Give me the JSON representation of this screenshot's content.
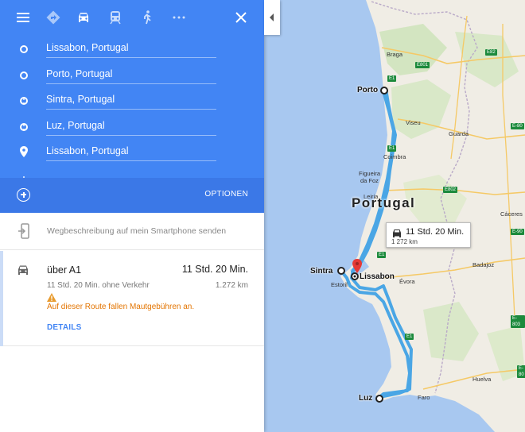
{
  "travel_modes": [
    {
      "name": "menu",
      "icon": "menu-icon"
    },
    {
      "name": "best",
      "icon": "directions-diamond-icon"
    },
    {
      "name": "car",
      "icon": "car-icon",
      "active": true
    },
    {
      "name": "transit",
      "icon": "train-icon"
    },
    {
      "name": "walk",
      "icon": "walk-icon"
    },
    {
      "name": "more",
      "icon": "more-icon"
    },
    {
      "name": "close",
      "icon": "close-icon"
    }
  ],
  "stops": [
    {
      "value": "Lissabon, Portugal"
    },
    {
      "value": "Porto, Portugal"
    },
    {
      "value": "Sintra, Portugal"
    },
    {
      "value": "Luz, Portugal"
    },
    {
      "value": "Lissabon, Portugal"
    }
  ],
  "options_label": "OPTIONEN",
  "send_to_phone": "Wegbeschreibung auf mein Smartphone senden",
  "route": {
    "via": "über A1",
    "duration": "11 Std. 20 Min.",
    "duration_no_traffic": "11 Std. 20 Min. ohne Verkehr",
    "distance": "1.272 km",
    "warning": "Auf dieser Route fallen Mautgebühren an.",
    "details_label": "DETAILS"
  },
  "map": {
    "country": "Portugal",
    "callout_time": "11 Std. 20 Min.",
    "callout_distance": "1 272 km",
    "cities": {
      "porto": "Porto",
      "sintra": "Sintra",
      "lissabon": "Lissabon",
      "luz": "Luz",
      "braga": "Braga",
      "viseu": "Viseu",
      "guarda": "Guarda",
      "coimbra": "Coimbra",
      "figueira": "Figueira",
      "da_foz": "da Foz",
      "leiria": "Leiria",
      "caceres": "Cáceres",
      "badajoz": "Badajoz",
      "evora": "Évora",
      "estoril": "Estoril",
      "faro": "Faro",
      "huelva": "Huelva"
    },
    "roads": {
      "e1_a": "E1",
      "e1_b": "E1",
      "e1_c": "E1",
      "e1_d": "E1",
      "e801": "E801",
      "e82": "E82",
      "e802": "E802",
      "e80": "E-80",
      "e90": "E-90",
      "e803": "E-803",
      "e80b": "E-80"
    }
  },
  "colors": {
    "header_blue": "#4285f4",
    "route_blue": "#4aa6e5",
    "warning_orange": "#e37400"
  }
}
